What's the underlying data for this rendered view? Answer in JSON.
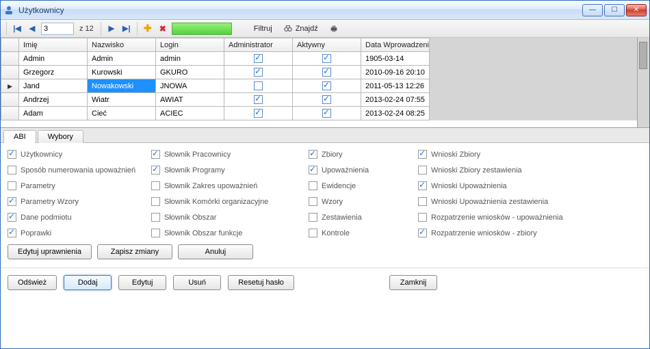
{
  "window": {
    "title": "Użytkownicy"
  },
  "nav": {
    "page": "3",
    "of_label": "z 12",
    "filter": "Filtruj",
    "find": "Znajdź"
  },
  "grid": {
    "columns": [
      "Imię",
      "Nazwisko",
      "Login",
      "Administrator",
      "Aktywny",
      "Data Wprowadzenia"
    ],
    "rows": [
      {
        "imie": "Admin",
        "nazwisko": "Admin",
        "login": "admin",
        "admin": true,
        "active": true,
        "date": "1905-03-14"
      },
      {
        "imie": "Grzegorz",
        "nazwisko": "Kurowski",
        "login": "GKURO",
        "admin": true,
        "active": true,
        "date": "2010-09-16 20:10"
      },
      {
        "imie": "Jand",
        "nazwisko": "Nowakowski",
        "login": "JNOWA",
        "admin": false,
        "active": true,
        "date": "2011-05-13 12:26",
        "selected": true
      },
      {
        "imie": "Andrzej",
        "nazwisko": "Wiatr",
        "login": "AWIAT",
        "admin": true,
        "active": true,
        "date": "2013-02-24 07:55"
      },
      {
        "imie": "Adam",
        "nazwisko": "Cieć",
        "login": "ACIEC",
        "admin": true,
        "active": true,
        "date": "2013-02-24 08:25"
      }
    ]
  },
  "tabs": {
    "abi": "ABI",
    "wybory": "Wybory",
    "active": "abi"
  },
  "perms": {
    "col1": [
      {
        "label": "Użytkownicy",
        "checked": true
      },
      {
        "label": "Sposób numerowania upoważnień",
        "checked": false
      },
      {
        "label": "Parametry",
        "checked": false
      },
      {
        "label": "Parametry Wzory",
        "checked": true
      },
      {
        "label": "Dane podmiotu",
        "checked": true
      },
      {
        "label": "Poprawki",
        "checked": true
      }
    ],
    "col2": [
      {
        "label": "Słownik Pracownicy",
        "checked": true
      },
      {
        "label": "Słownik Programy",
        "checked": true
      },
      {
        "label": "Słownik Zakres upoważnień",
        "checked": false
      },
      {
        "label": "Słownik Komórki organizacyjne",
        "checked": false
      },
      {
        "label": "Słownik Obszar",
        "checked": false
      },
      {
        "label": "Słownik Obszar funkcje",
        "checked": false
      }
    ],
    "col3": [
      {
        "label": "Zbiory",
        "checked": true
      },
      {
        "label": "Upoważnienia",
        "checked": true
      },
      {
        "label": "Ewidencje",
        "checked": false
      },
      {
        "label": "Wzory",
        "checked": false
      },
      {
        "label": "Zestawienia",
        "checked": false
      },
      {
        "label": "Kontrole",
        "checked": false
      }
    ],
    "col4": [
      {
        "label": "Wnioski Zbiory",
        "checked": true
      },
      {
        "label": "Wnioski Zbiory zestawienia",
        "checked": false
      },
      {
        "label": "Wnioski Upoważnienia",
        "checked": true
      },
      {
        "label": "Wnioski Upoważnienia zestawienia",
        "checked": false
      },
      {
        "label": "Rozpatrzenie wniosków - upoważnienia",
        "checked": false
      },
      {
        "label": "Rozpatrzenie wniosków - zbiory",
        "checked": true
      }
    ]
  },
  "buttons": {
    "edit_perms": "Edytuj uprawnienia",
    "save_changes": "Zapisz zmiany",
    "cancel": "Anuluj",
    "refresh": "Odśwież",
    "add": "Dodaj",
    "edit": "Edytuj",
    "delete": "Usuń",
    "reset_pw": "Resetuj hasło",
    "close": "Zamknij"
  }
}
